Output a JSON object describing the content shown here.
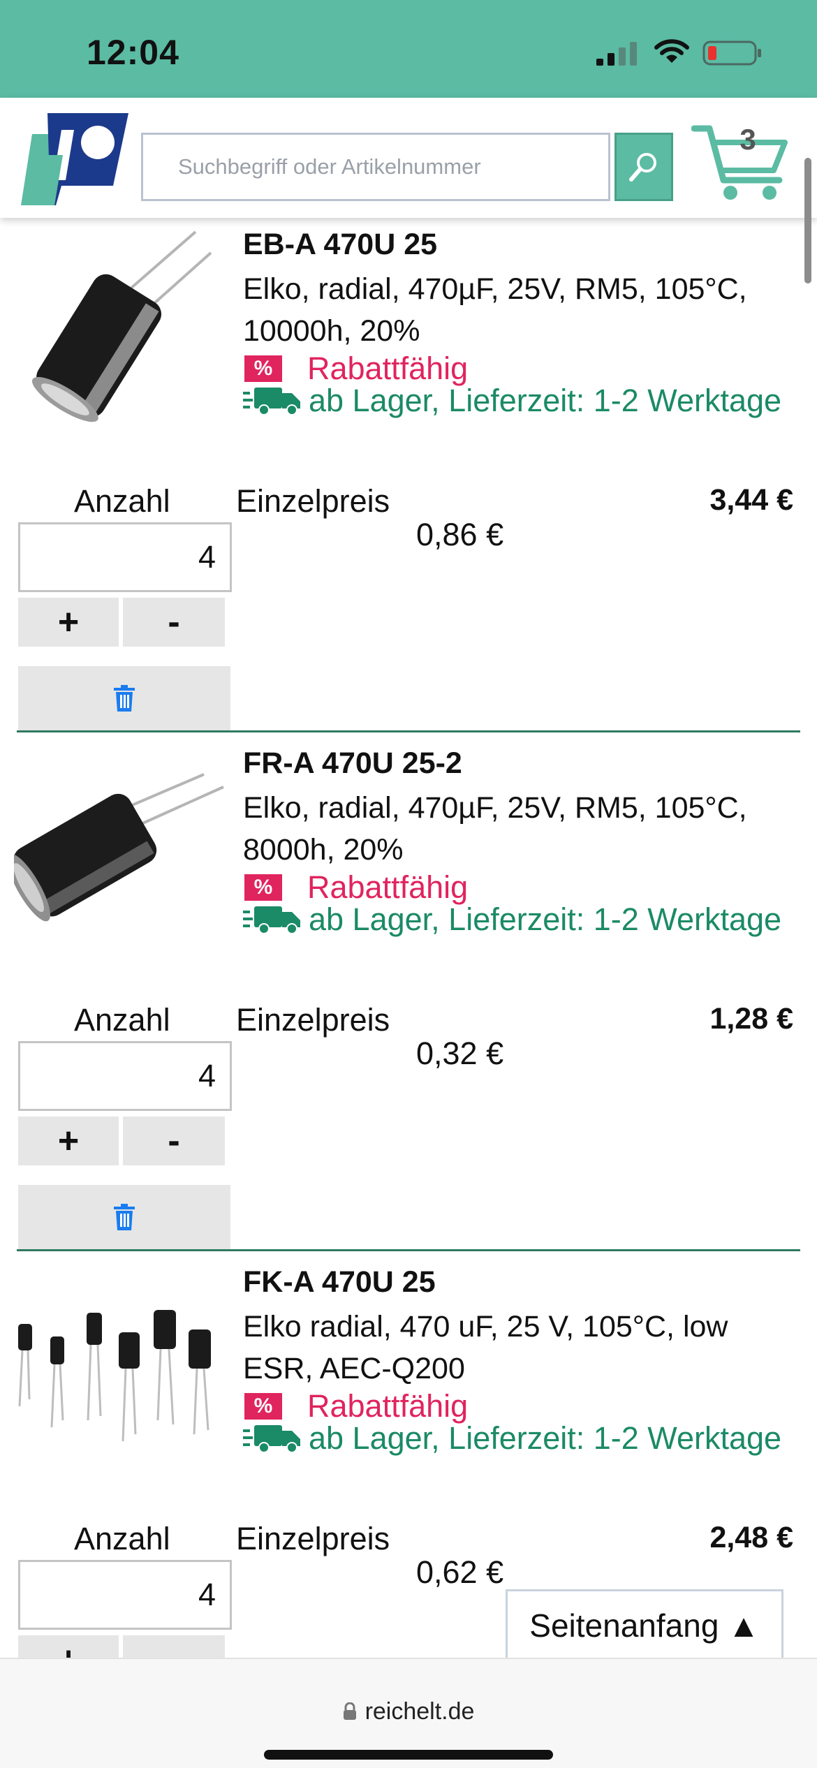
{
  "status_bar": {
    "time": "12:04"
  },
  "header": {
    "search": {
      "placeholder": "Suchbegriff oder Artikelnummer"
    },
    "cart": {
      "count": "3"
    }
  },
  "products": [
    {
      "title": "EB-A 470U 25",
      "description": "Elko, radial, 470µF, 25V, RM5, 105°C, 10000h, 20%",
      "badge": "%",
      "discount_label": "Rabattfähig",
      "stock": "ab Lager,  Lieferzeit: 1-2 Werktage",
      "qty_label": "Anzahl",
      "unit_label": "Einzelpreis",
      "quantity": "4",
      "unit_price": "0,86 €",
      "total_price": "3,44 €",
      "plus": "+",
      "minus": "-"
    },
    {
      "title": "FR-A 470U 25-2",
      "description": "Elko, radial, 470µF, 25V, RM5, 105°C, 8000h, 20%",
      "badge": "%",
      "discount_label": "Rabattfähig",
      "stock": "ab Lager,  Lieferzeit: 1-2 Werktage",
      "qty_label": "Anzahl",
      "unit_label": "Einzelpreis",
      "quantity": "4",
      "unit_price": "0,32 €",
      "total_price": "1,28 €",
      "plus": "+",
      "minus": "-"
    },
    {
      "title": "FK-A 470U 25",
      "description": "Elko radial, 470 uF, 25 V, 105°C, low ESR, AEC-Q200",
      "badge": "%",
      "discount_label": "Rabattfähig",
      "stock": "ab Lager,  Lieferzeit: 1-2 Werktage",
      "qty_label": "Anzahl",
      "unit_label": "Einzelpreis",
      "quantity": "4",
      "unit_price": "0,62 €",
      "total_price": "2,48 €",
      "plus": "+",
      "minus": "-"
    }
  ],
  "back_to_top": "Seitenanfang ▲",
  "browser": {
    "url": "reichelt.de"
  },
  "colors": {
    "brand_green": "#5bbba3",
    "stock_green": "#1b8a66",
    "discount_red": "#e0245e",
    "delete_blue": "#1a7cf0"
  }
}
